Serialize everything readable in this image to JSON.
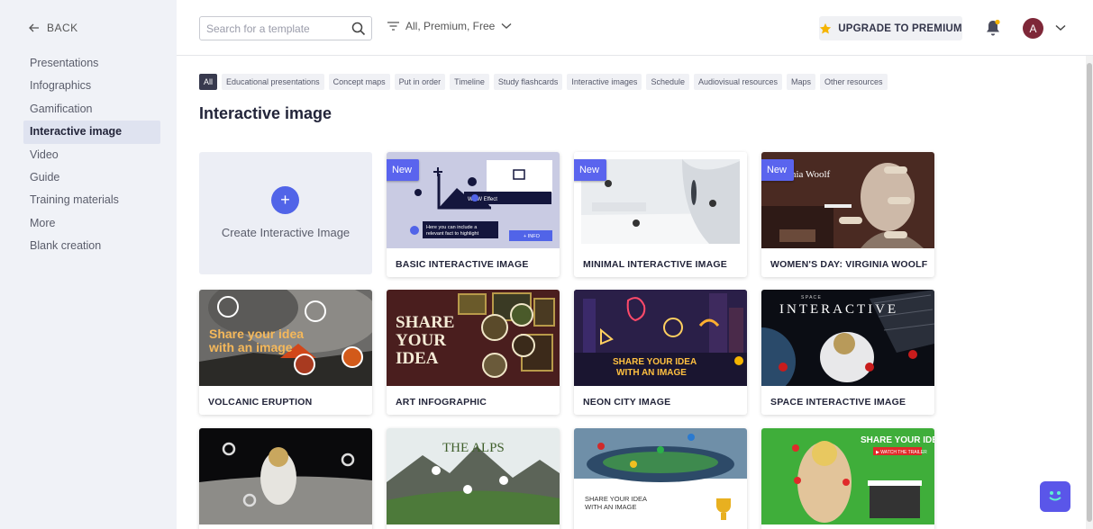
{
  "sidebar": {
    "back_label": "BACK",
    "items": [
      {
        "label": "Presentations"
      },
      {
        "label": "Infographics"
      },
      {
        "label": "Gamification"
      },
      {
        "label": "Interactive image",
        "active": true
      },
      {
        "label": "Video"
      },
      {
        "label": "Guide"
      },
      {
        "label": "Training materials"
      },
      {
        "label": "More"
      },
      {
        "label": "Blank creation"
      }
    ]
  },
  "header": {
    "search_placeholder": "Search for a template",
    "filter_label": "All, Premium, Free",
    "premium_label": "UPGRADE TO PREMIUM",
    "avatar_initial": "A"
  },
  "chips": [
    {
      "label": "All",
      "active": true
    },
    {
      "label": "Educational presentations"
    },
    {
      "label": "Concept maps"
    },
    {
      "label": "Put in order"
    },
    {
      "label": "Timeline"
    },
    {
      "label": "Study flashcards"
    },
    {
      "label": "Interactive images"
    },
    {
      "label": "Schedule"
    },
    {
      "label": "Audiovisual resources"
    },
    {
      "label": "Maps"
    },
    {
      "label": "Other resources"
    }
  ],
  "page_title": "Interactive image",
  "create_label": "Create Interactive Image",
  "badge_label": "New",
  "cards": [
    {
      "name": "BASIC INTERACTIVE IMAGE",
      "is_new": true
    },
    {
      "name": "MINIMAL INTERACTIVE IMAGE",
      "is_new": true
    },
    {
      "name": "WOMEN'S DAY: VIRGINIA WOOLF",
      "is_new": true
    },
    {
      "name": "VOLCANIC ERUPTION"
    },
    {
      "name": "ART INFOGRAPHIC"
    },
    {
      "name": "NEON CITY IMAGE"
    },
    {
      "name": "SPACE INTERACTIVE IMAGE"
    }
  ],
  "thumb_text": {
    "basic_wow": "WOW Effect",
    "basic_note_1": "Here you can include a",
    "basic_note_2": "relevant fact to highlight",
    "basic_info": "+ INFO",
    "woolf": "nia Woolf",
    "volcano_1": "Share your idea",
    "volcano_2": "with an image",
    "art_1": "SHARE",
    "art_2": "YOUR",
    "art_3": "IDEA",
    "neon_1": "SHARE YOUR IDEA",
    "neon_2": "WITH AN IMAGE",
    "space_top": "S P A C E",
    "space": "INTERACTIVE",
    "alps": "THE ALPS",
    "stadium_1": "SHARE YOUR IDEA",
    "stadium_2": "WITH AN IMAGE",
    "green": "SHARE YOUR IDEA",
    "green_sub": "▶ WATCH THE TRAILER"
  },
  "colors": {
    "accent": "#5164e8",
    "badge": "#5a64ee",
    "sidebar_bg": "#f0f2f7",
    "chip_active": "#383a4e",
    "premium_star": "#f5b400",
    "avatar": "#7e2738"
  }
}
